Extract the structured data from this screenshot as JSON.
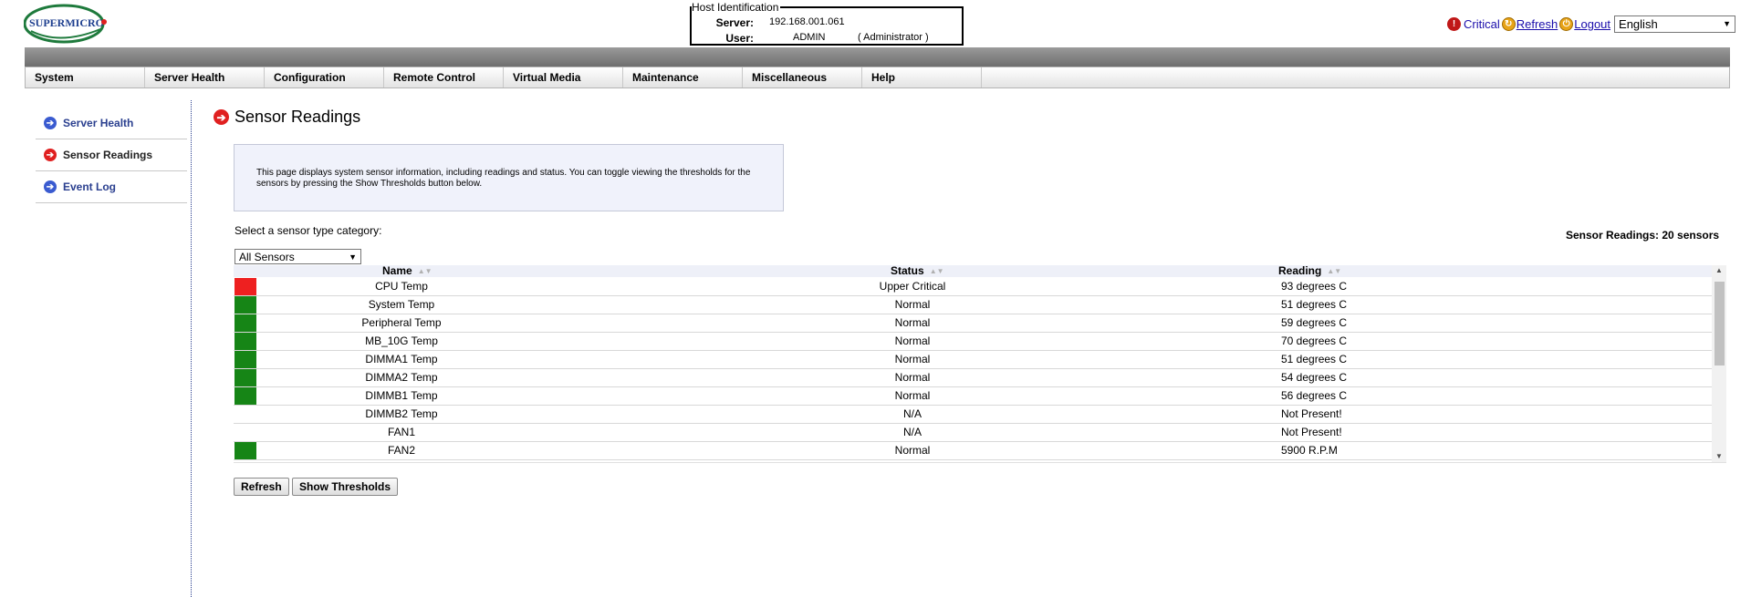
{
  "header": {
    "logo_text": "SUPERMICRO",
    "host": {
      "legend": "Host Identification",
      "server_label": "Server:",
      "server_value": "192.168.001.061",
      "user_label": "User:",
      "user_value": "ADMIN",
      "user_role": "( Administrator )"
    },
    "links": {
      "critical": "Critical",
      "refresh": "Refresh",
      "logout": "Logout"
    },
    "language": "English"
  },
  "nav": [
    "System",
    "Server Health",
    "Configuration",
    "Remote Control",
    "Virtual Media",
    "Maintenance",
    "Miscellaneous",
    "Help"
  ],
  "sidebar": [
    {
      "label": "Server Health",
      "active": false
    },
    {
      "label": "Sensor Readings",
      "active": true
    },
    {
      "label": "Event Log",
      "active": false
    }
  ],
  "main": {
    "title": "Sensor Readings",
    "info": "This page displays system sensor information, including readings and status. You can toggle viewing the thresholds for the sensors by pressing the Show Thresholds button below.",
    "select_label": "Select a sensor type category:",
    "category": "All Sensors",
    "count_text": "Sensor Readings: 20 sensors",
    "columns": {
      "name": "Name",
      "status": "Status",
      "reading": "Reading"
    },
    "rows": [
      {
        "name": "CPU Temp",
        "status": "Upper Critical",
        "reading": "93 degrees C",
        "state": "critical"
      },
      {
        "name": "System Temp",
        "status": "Normal",
        "reading": "51 degrees C",
        "state": "normal"
      },
      {
        "name": "Peripheral Temp",
        "status": "Normal",
        "reading": "59 degrees C",
        "state": "normal"
      },
      {
        "name": "MB_10G Temp",
        "status": "Normal",
        "reading": "70 degrees C",
        "state": "normal"
      },
      {
        "name": "DIMMA1 Temp",
        "status": "Normal",
        "reading": "51 degrees C",
        "state": "normal"
      },
      {
        "name": "DIMMA2 Temp",
        "status": "Normal",
        "reading": "54 degrees C",
        "state": "normal"
      },
      {
        "name": "DIMMB1 Temp",
        "status": "Normal",
        "reading": "56 degrees C",
        "state": "normal"
      },
      {
        "name": "DIMMB2 Temp",
        "status": "N/A",
        "reading": "Not Present!",
        "state": "none"
      },
      {
        "name": "FAN1",
        "status": "N/A",
        "reading": "Not Present!",
        "state": "none"
      },
      {
        "name": "FAN2",
        "status": "Normal",
        "reading": "5900 R.P.M",
        "state": "normal"
      }
    ],
    "buttons": {
      "refresh": "Refresh",
      "show_thresholds": "Show Thresholds"
    }
  },
  "colors": {
    "critical": "#ee2020",
    "normal": "#168516",
    "link": "#2a3f8f",
    "logo": "#1e7a3c"
  }
}
